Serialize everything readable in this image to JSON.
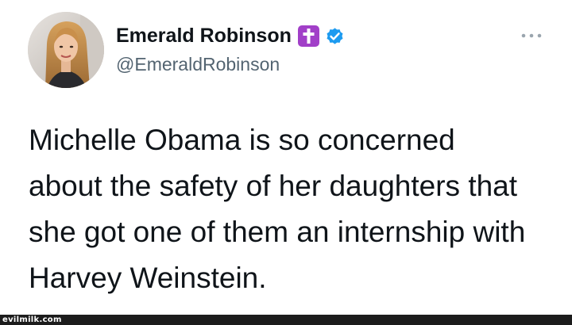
{
  "tweet": {
    "author": {
      "display_name": "Emerald Robinson",
      "handle": "@EmeraldRobinson",
      "name_badge_icon": "latin-cross-emoji-icon",
      "verified_icon": "verified-badge-icon",
      "avatar_icon": "avatar-photo"
    },
    "menu_icon": "more-options-icon",
    "text_lines": [
      "Michelle Obama is so concerned",
      "about the safety of her daughters that",
      "she got one of them an internship with",
      "Harvey Weinstein."
    ]
  },
  "watermark": {
    "text": "evilmilk.com"
  },
  "colors": {
    "background": "#ffffff",
    "primary_text": "#0f1419",
    "secondary_text": "#536471",
    "verified_blue": "#1d9bf0",
    "cross_emoji_bg": "#a13fc8",
    "watermark_bar": "#1c1c1c"
  }
}
